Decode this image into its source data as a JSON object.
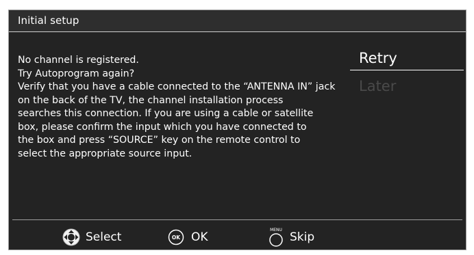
{
  "dialog": {
    "title": "Initial setup",
    "message_lines": [
      "No channel is registered.",
      "Try Autoprogram again?",
      "Verify that you have a cable connected to the “ANTENNA IN” jack",
      "on the back of the TV, the channel installation process",
      "searches this connection. If you are using a cable or satellite",
      "box, please confirm the input which you have connected to",
      "the box and press “SOURCE” key on the remote control to",
      "select the appropriate source input."
    ]
  },
  "menu": {
    "items": [
      {
        "label": "Retry",
        "state": "selected"
      },
      {
        "label": "Later",
        "state": "disabled"
      }
    ]
  },
  "footer": {
    "select_icon": "dpad-icon",
    "select_label": "Select",
    "ok_icon": "ok-button-icon",
    "ok_icon_text": "OK",
    "ok_label": "OK",
    "menu_icon": "menu-button-icon",
    "menu_icon_text": "MENU",
    "skip_label": "Skip"
  },
  "colors": {
    "background": "#232323",
    "text": "#ffffff",
    "disabled_text": "#4a4a4a",
    "divider": "#9e9e9e"
  }
}
